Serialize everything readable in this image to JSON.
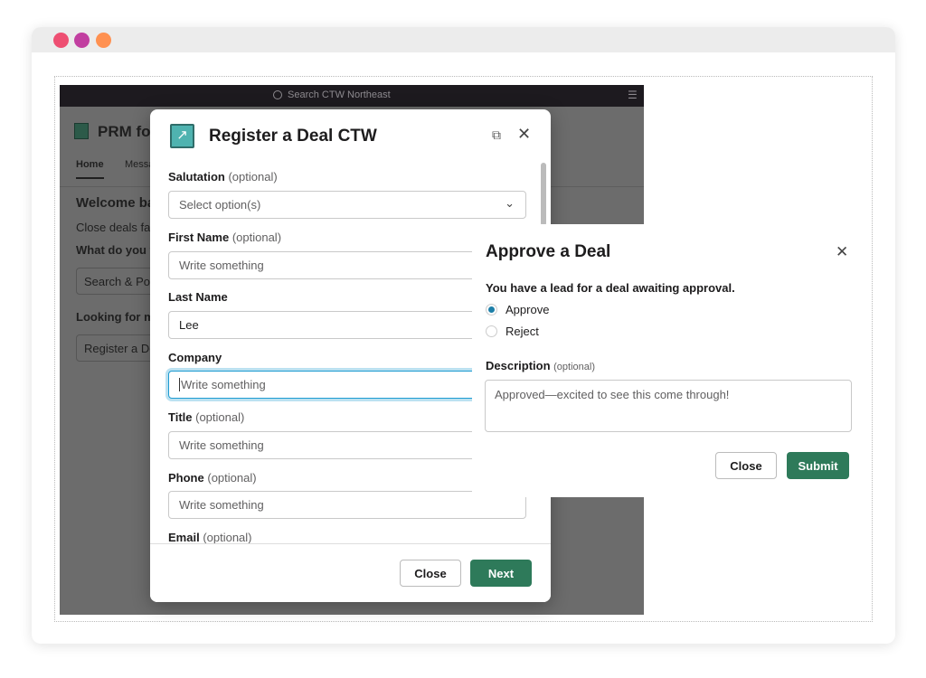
{
  "browser": {
    "dots": [
      "#ee4f72",
      "#c13fa0",
      "#ff9151"
    ]
  },
  "app": {
    "search_placeholder": "Search CTW Northeast",
    "title": "PRM for",
    "tabs": [
      "Home",
      "Messa"
    ],
    "welcome": "Welcome ba",
    "subtitle": "Close deals fas",
    "question": "What do you v",
    "search_button": "Search & Pos",
    "looking": "Looking for mo",
    "register_button": "Register a De"
  },
  "register_modal": {
    "title": "Register a Deal CTW",
    "fields": [
      {
        "label": "Salutation",
        "optional": "(optional)",
        "type": "select",
        "placeholder": "Select option(s)",
        "value": ""
      },
      {
        "label": "First Name",
        "optional": "(optional)",
        "placeholder": "Write something",
        "value": ""
      },
      {
        "label": "Last Name",
        "optional": "",
        "placeholder": "Write something",
        "value": "Lee"
      },
      {
        "label": "Company",
        "optional": "",
        "placeholder": "Write something",
        "value": "",
        "focused": true
      },
      {
        "label": "Title",
        "optional": "(optional)",
        "placeholder": "Write something",
        "value": ""
      },
      {
        "label": "Phone",
        "optional": "(optional)",
        "placeholder": "Write something",
        "value": ""
      },
      {
        "label": "Email",
        "optional": "(optional)"
      }
    ],
    "close_label": "Close",
    "next_label": "Next"
  },
  "approve_modal": {
    "title": "Approve a Deal",
    "prompt": "You have a lead for a deal awaiting approval.",
    "options": [
      {
        "label": "Approve",
        "selected": true
      },
      {
        "label": "Reject",
        "selected": false
      }
    ],
    "description_label": "Description",
    "description_optional": "(optional)",
    "description_value": "Approved—excited to see this come through!",
    "close_label": "Close",
    "submit_label": "Submit"
  },
  "colors": {
    "primary": "#2e7a5a",
    "radio": "#1d7fa8",
    "focus": "#1d9bd1"
  }
}
